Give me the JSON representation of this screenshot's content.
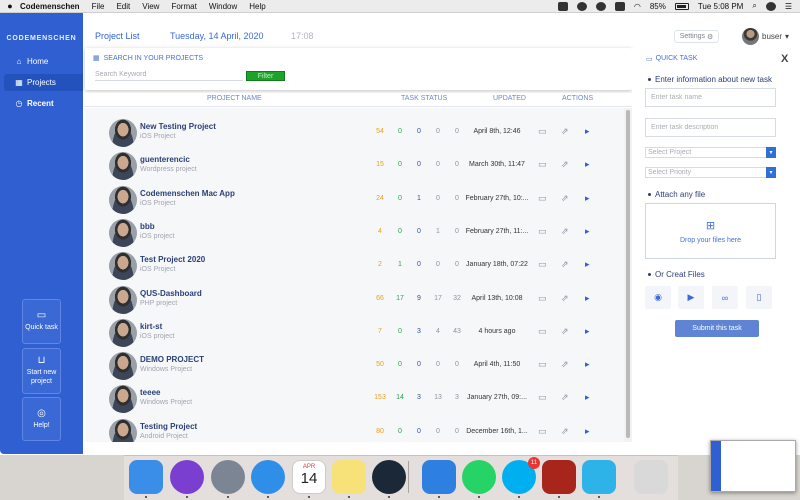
{
  "menubar": {
    "app_name": "Codemenschen",
    "menus": [
      "File",
      "Edit",
      "View",
      "Format",
      "Window",
      "Help"
    ],
    "battery": "85%",
    "clock": "Tue 5:08 PM"
  },
  "sidebar": {
    "brand": "CODEMENSCHEN",
    "nav": [
      {
        "label": "Home",
        "icon": "home-icon"
      },
      {
        "label": "Projects",
        "icon": "grid-icon"
      },
      {
        "label": "Recent",
        "icon": "clock-icon"
      }
    ],
    "buttons": [
      {
        "label": "Quick task",
        "icon": "chat-icon"
      },
      {
        "label": "Start new project",
        "icon": "inbox-icon"
      },
      {
        "label": "Help!",
        "icon": "lifebuoy-icon"
      }
    ]
  },
  "header": {
    "title": "Project List",
    "date": "Tuesday, 14 April, 2020",
    "time": "17:08",
    "settings": "Settings",
    "user": "buser"
  },
  "search": {
    "label": "SEARCH IN YOUR PROJECTS",
    "placeholder": "Search Keyword",
    "filter": "Filter"
  },
  "table": {
    "headers": {
      "name": "PROJECT NAME",
      "status": "TASK STATUS",
      "updated": "UPDATED",
      "actions": "ACTIONS"
    },
    "status_colors": [
      "#e6a21c",
      "#2aa348",
      "#2f4fa8",
      "#8d939e",
      "#8d939e"
    ],
    "rows": [
      {
        "name": "New Testing Project",
        "type": "iOS Project",
        "s": [
          "54",
          "0",
          "0",
          "0",
          "0"
        ],
        "updated": "April 8th, 12:46"
      },
      {
        "name": "guenterencic",
        "type": "Wordpress project",
        "s": [
          "15",
          "0",
          "0",
          "0",
          "0"
        ],
        "updated": "March 30th, 11:47"
      },
      {
        "name": "Codemenschen Mac App",
        "type": "iOS Project",
        "s": [
          "24",
          "0",
          "1",
          "0",
          "0"
        ],
        "updated": "February 27th, 10:..."
      },
      {
        "name": "bbb",
        "type": "iOS project",
        "s": [
          "4",
          "0",
          "0",
          "1",
          "0"
        ],
        "updated": "February 27th, 11:..."
      },
      {
        "name": "Test Project 2020",
        "type": "iOS Project",
        "s": [
          "2",
          "1",
          "0",
          "0",
          "0"
        ],
        "updated": "January 18th, 07:22"
      },
      {
        "name": "QUS-Dashboard",
        "type": "PHP project",
        "s": [
          "66",
          "17",
          "9",
          "17",
          "32"
        ],
        "updated": "April 13th, 10:08"
      },
      {
        "name": "kirt-st",
        "type": "iOS project",
        "s": [
          "7",
          "0",
          "3",
          "4",
          "43"
        ],
        "updated": "4 hours ago"
      },
      {
        "name": "DEMO PROJECT",
        "type": "Windows Project",
        "s": [
          "50",
          "0",
          "0",
          "0",
          "0"
        ],
        "updated": "April 4th, 11:50"
      },
      {
        "name": "teeee",
        "type": "Windows Project",
        "s": [
          "153",
          "14",
          "3",
          "13",
          "3"
        ],
        "updated": "January 27th, 09:..."
      },
      {
        "name": "Testing Project",
        "type": "Android Project",
        "s": [
          "80",
          "0",
          "0",
          "0",
          "0"
        ],
        "updated": "December 16th, 1..."
      }
    ]
  },
  "quick_task": {
    "title": "QUICK TASK",
    "close": "X",
    "enter_info": "Enter information about new task",
    "task_name_ph": "Enter task name",
    "task_desc_ph": "Enter task description",
    "select_project": "Select Project",
    "select_priority": "Select Priority",
    "attach": "Attach any file",
    "drop": "Drop your files here",
    "create_files": "Or Creat Files",
    "submit": "Submit this task"
  },
  "dock": {
    "calendar_month": "APR",
    "calendar_day": "14",
    "skype_badge": "11",
    "apps": [
      {
        "name": "finder-icon",
        "color": "#3b8ee8"
      },
      {
        "name": "siri-icon",
        "color": "#7a3fd0"
      },
      {
        "name": "launchpad-icon",
        "color": "#7b8594"
      },
      {
        "name": "safari-icon",
        "color": "#2f8fe8"
      },
      {
        "name": "calendar-icon",
        "color": "#ffffff"
      },
      {
        "name": "notes-icon",
        "color": "#f7e27a"
      },
      {
        "name": "steam-icon",
        "color": "#1b2838"
      },
      {
        "name": "xcode-icon",
        "color": "#2d7fe0"
      },
      {
        "name": "whatsapp-icon",
        "color": "#25d366"
      },
      {
        "name": "skype-icon",
        "color": "#00aff0"
      },
      {
        "name": "dota-icon",
        "color": "#a8251c"
      },
      {
        "name": "codemenschen-icon",
        "color": "#2db3e8"
      },
      {
        "name": "trash-icon",
        "color": "#d9d9d9"
      }
    ]
  }
}
